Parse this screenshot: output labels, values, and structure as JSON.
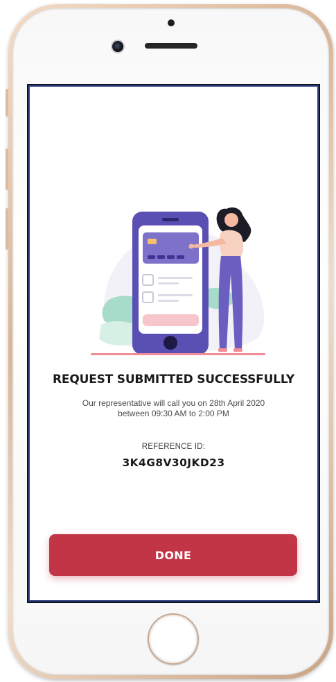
{
  "confirmation": {
    "headline": "REQUEST SUBMITTED SUCCESSFULLY",
    "message_line1": "Our representative will call you on 28th April 2020",
    "message_line2": "between 09:30 AM to 2:00 PM",
    "reference_label": "REFERENCE ID:",
    "reference_id": "3K4G8V30JKD23"
  },
  "actions": {
    "done_label": "DONE"
  },
  "colors": {
    "primary": "#c23546",
    "phone_illustration": "#5a4fb3",
    "card": "#7d71c9",
    "accent_pink": "#f6c6cc",
    "leaf_green": "#8fd3bd"
  },
  "icons": {
    "illustration": "woman-with-phone-illustration",
    "home": "home-button"
  }
}
